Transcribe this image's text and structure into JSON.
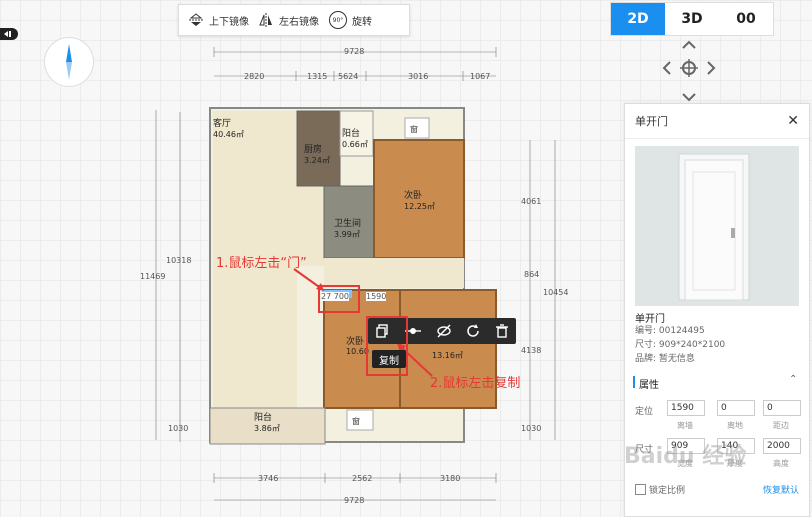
{
  "toolbar": {
    "flip_vertical": "上下镜像",
    "flip_horizontal": "左右镜像",
    "rotate": "旋转",
    "rotate_badge": "90°"
  },
  "view_toggle": {
    "mode_2d": "2D",
    "mode_3d": "3D",
    "mode_other": "00"
  },
  "dims": {
    "top_total": "9728",
    "top_segments": [
      "2820",
      "1315",
      "5624",
      "3016",
      "1067"
    ],
    "bottom_segments": [
      "3746",
      "2562",
      "3180"
    ],
    "bottom_total": "9728",
    "left_outer": "11469",
    "left_inner": "10318",
    "left_bottom": "1030",
    "right_a": "4061",
    "right_b": "864",
    "right_c": "4138",
    "right_d": "1030",
    "right_total": "10454",
    "door_width": "27 700",
    "door_offset": "1590"
  },
  "rooms": {
    "living": {
      "name": "客厅",
      "area": "40.46㎡"
    },
    "kitchen": {
      "name": "厨房",
      "area": "3.24㎡"
    },
    "balcony_top": {
      "name": "阳台",
      "area": "0.66㎡"
    },
    "bedroom2": {
      "name": "次卧",
      "area": "12.25㎡"
    },
    "bathroom": {
      "name": "卫生间",
      "area": "3.99㎡"
    },
    "bedroom3": {
      "name": "次卧",
      "area": "10.60"
    },
    "bedroom4": {
      "name": "",
      "area": "13.16㎡"
    },
    "balcony_bottom": {
      "name": "阳台",
      "area": "3.86㎡"
    },
    "window_badge_top": "窗",
    "window_badge_bottom": "窗"
  },
  "annotations": {
    "step1": "1.鼠标左击“门”",
    "step2": "2.鼠标左击复制"
  },
  "context_menu": {
    "copy_tooltip": "复制"
  },
  "panel": {
    "title": "单开门",
    "item_name": "单开门",
    "code": "编号: 00124495",
    "size": "尺寸: 909*240*2100",
    "brand": "品牌: 暂无信息",
    "section": "属性",
    "position_label": "定位",
    "position_values": [
      "1590",
      "0",
      "0"
    ],
    "position_subs": [
      "离墙",
      "离地",
      "距边"
    ],
    "size_label": "尺寸",
    "size_values": [
      "909",
      "140",
      "2000"
    ],
    "size_subs": [
      "宽度",
      "厚度",
      "高度"
    ],
    "lock_label": "锁定比例",
    "restore_label": "恢复默认"
  },
  "watermark": "Baidu 经验"
}
